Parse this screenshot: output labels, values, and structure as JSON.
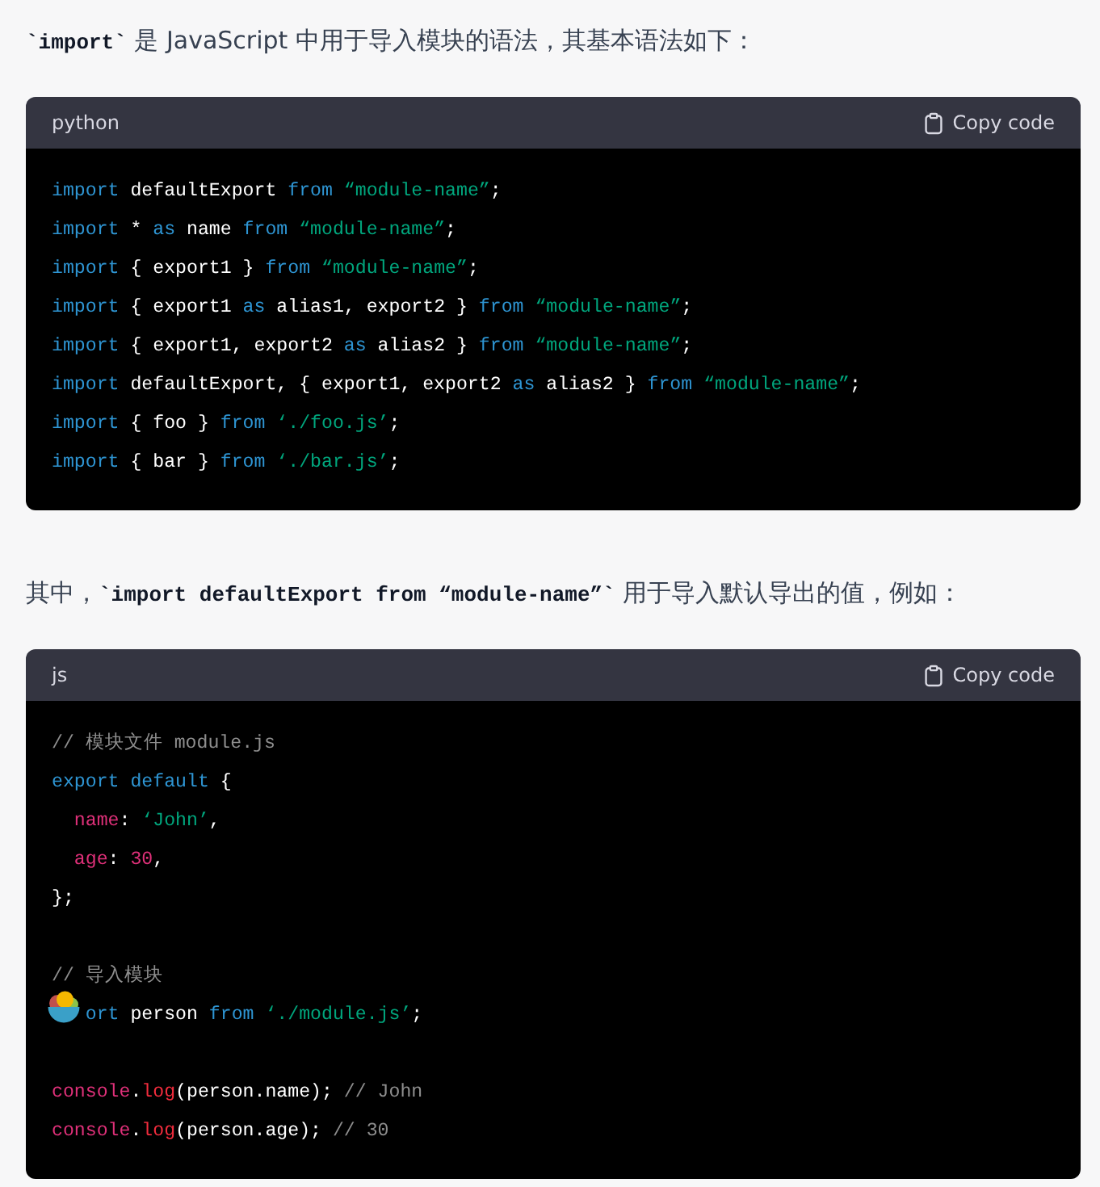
{
  "blocks": [
    {
      "kind": "para",
      "text": "**`import`** 是 JavaScript 中用于导入模块的语法，其基本语法如下："
    },
    {
      "kind": "code",
      "language": "python",
      "copy_label": "Copy code",
      "lines": [
        {
          "kind": "code",
          "tokens": [
            {
              "t": "import",
              "kind": "kw"
            },
            {
              "t": " defaultExport ",
              "kind": "plain"
            },
            {
              "t": "from",
              "kind": "kw"
            },
            {
              "t": " “module-name”",
              "kind": "str"
            },
            {
              "t": ";",
              "kind": "plain"
            }
          ]
        },
        {
          "kind": "code",
          "tokens": [
            {
              "t": "import",
              "kind": "kw"
            },
            {
              "t": " * ",
              "kind": "plain"
            },
            {
              "t": "as",
              "kind": "kw"
            },
            {
              "t": " name ",
              "kind": "plain"
            },
            {
              "t": "from",
              "kind": "kw"
            },
            {
              "t": " “module-name”",
              "kind": "str"
            },
            {
              "t": ";",
              "kind": "plain"
            }
          ]
        },
        {
          "kind": "code",
          "tokens": [
            {
              "t": "import",
              "kind": "kw"
            },
            {
              "t": " { export1 } ",
              "kind": "plain"
            },
            {
              "t": "from",
              "kind": "kw"
            },
            {
              "t": " “module-name”",
              "kind": "str"
            },
            {
              "t": ";",
              "kind": "plain"
            }
          ]
        },
        {
          "kind": "code",
          "tokens": [
            {
              "t": "import",
              "kind": "kw"
            },
            {
              "t": " { export1 ",
              "kind": "plain"
            },
            {
              "t": "as",
              "kind": "kw"
            },
            {
              "t": " alias1, export2 } ",
              "kind": "plain"
            },
            {
              "t": "from",
              "kind": "kw"
            },
            {
              "t": " “module-name”",
              "kind": "str"
            },
            {
              "t": ";",
              "kind": "plain"
            }
          ]
        },
        {
          "kind": "code",
          "tokens": [
            {
              "t": "import",
              "kind": "kw"
            },
            {
              "t": " { export1, export2 ",
              "kind": "plain"
            },
            {
              "t": "as",
              "kind": "kw"
            },
            {
              "t": " alias2 } ",
              "kind": "plain"
            },
            {
              "t": "from",
              "kind": "kw"
            },
            {
              "t": " “module-name”",
              "kind": "str"
            },
            {
              "t": ";",
              "kind": "plain"
            }
          ]
        },
        {
          "kind": "code",
          "tokens": [
            {
              "t": "import",
              "kind": "kw"
            },
            {
              "t": " defaultExport, { export1, export2 ",
              "kind": "plain"
            },
            {
              "t": "as",
              "kind": "kw"
            },
            {
              "t": " alias2 } ",
              "kind": "plain"
            },
            {
              "t": "from",
              "kind": "kw"
            },
            {
              "t": " “module-name”",
              "kind": "str"
            },
            {
              "t": ";",
              "kind": "plain"
            }
          ]
        },
        {
          "kind": "code",
          "tokens": [
            {
              "t": "import",
              "kind": "kw"
            },
            {
              "t": " { foo } ",
              "kind": "plain"
            },
            {
              "t": "from",
              "kind": "kw"
            },
            {
              "t": " ‘./foo.js’",
              "kind": "str"
            },
            {
              "t": ";",
              "kind": "plain"
            }
          ]
        },
        {
          "kind": "code",
          "tokens": [
            {
              "t": "import",
              "kind": "kw"
            },
            {
              "t": " { bar } ",
              "kind": "plain"
            },
            {
              "t": "from",
              "kind": "kw"
            },
            {
              "t": " ‘./bar.js’",
              "kind": "str"
            },
            {
              "t": ";",
              "kind": "plain"
            }
          ]
        }
      ]
    },
    {
      "kind": "para",
      "text": "其中，**`import defaultExport from “module-name”`** 用于导入默认导出的值，例如："
    },
    {
      "kind": "code",
      "language": "js",
      "copy_label": "Copy code",
      "lines": [
        {
          "kind": "code",
          "tokens": [
            {
              "t": "// 模块文件 module.js",
              "kind": "comment"
            }
          ]
        },
        {
          "kind": "code",
          "tokens": [
            {
              "t": "export",
              "kind": "kw"
            },
            {
              "t": " default",
              "kind": "kw"
            },
            {
              "t": " {",
              "kind": "plain"
            }
          ]
        },
        {
          "kind": "code",
          "tokens": [
            {
              "t": "  name",
              "kind": "prop"
            },
            {
              "t": ": ",
              "kind": "plain"
            },
            {
              "t": "‘John’",
              "kind": "str"
            },
            {
              "t": ",",
              "kind": "plain"
            }
          ]
        },
        {
          "kind": "code",
          "tokens": [
            {
              "t": "  age",
              "kind": "prop"
            },
            {
              "t": ": ",
              "kind": "plain"
            },
            {
              "t": "30",
              "kind": "num"
            },
            {
              "t": ",",
              "kind": "plain"
            }
          ]
        },
        {
          "kind": "code",
          "tokens": [
            {
              "t": "};",
              "kind": "plain"
            }
          ]
        },
        {
          "kind": "blank"
        },
        {
          "kind": "code",
          "tokens": [
            {
              "t": "// 导入模块",
              "kind": "comment"
            }
          ]
        },
        {
          "kind": "covered",
          "tokens": [
            {
              "t": "   ort",
              "kind": "kw"
            },
            {
              "t": " person ",
              "kind": "plain"
            },
            {
              "t": "from",
              "kind": "kw"
            },
            {
              "t": " ‘./module.js’",
              "kind": "str"
            },
            {
              "t": ";",
              "kind": "plain"
            }
          ]
        },
        {
          "kind": "blank"
        },
        {
          "kind": "code",
          "tokens": [
            {
              "t": "console",
              "kind": "prop"
            },
            {
              "t": ".",
              "kind": "plain"
            },
            {
              "t": "log",
              "kind": "fn"
            },
            {
              "t": "(person.name); ",
              "kind": "plain"
            },
            {
              "t": "// John",
              "kind": "comment"
            }
          ]
        },
        {
          "kind": "code",
          "tokens": [
            {
              "t": "console",
              "kind": "prop"
            },
            {
              "t": ".",
              "kind": "plain"
            },
            {
              "t": "log",
              "kind": "fn"
            },
            {
              "t": "(person.age); ",
              "kind": "plain"
            },
            {
              "t": "// 30",
              "kind": "comment"
            }
          ]
        }
      ]
    }
  ]
}
